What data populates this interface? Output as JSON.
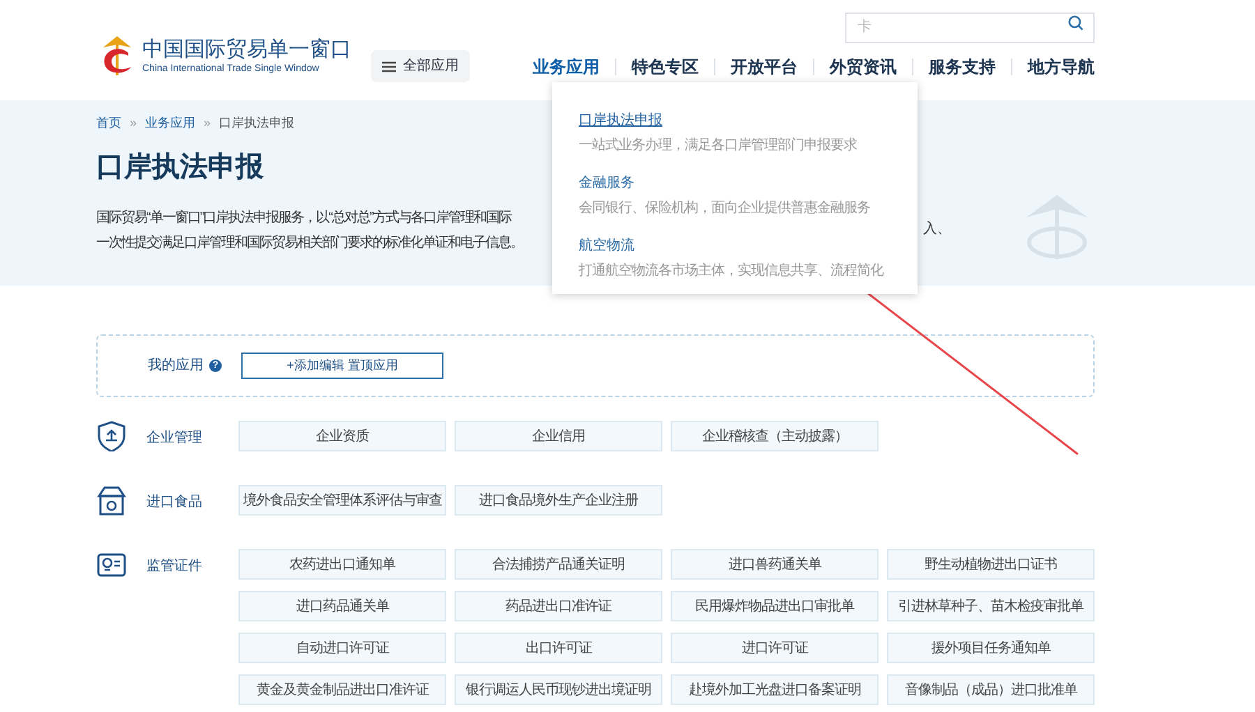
{
  "header": {
    "logo_title": "中国国际贸易单一窗口",
    "logo_subtitle": "China International Trade Single Window",
    "all_apps_button": "全部应用",
    "search": {
      "placeholder": "卡"
    },
    "nav": [
      {
        "label": "业务应用",
        "expanded": true
      },
      {
        "label": "特色专区",
        "expanded": false
      },
      {
        "label": "开放平台",
        "expanded": false
      },
      {
        "label": "外贸资讯",
        "expanded": false
      },
      {
        "label": "服务支持",
        "expanded": false
      },
      {
        "label": "地方导航",
        "expanded": false
      }
    ]
  },
  "dropdown": {
    "items": [
      {
        "title": "口岸执法申报",
        "description": "一站式业务办理，满足各口岸管理部门申报要求",
        "selected": true
      },
      {
        "title": "金融服务",
        "description": "会同银行、保险机构，面向企业提供普惠金融服务",
        "selected": false
      },
      {
        "title": "航空物流",
        "description": "打通航空物流各市场主体，实现信息共享、流程简化",
        "selected": false
      }
    ]
  },
  "breadcrumb": [
    {
      "label": "首页",
      "kind": "link"
    },
    {
      "label": "»",
      "kind": "separator"
    },
    {
      "label": "业务应用",
      "kind": "link"
    },
    {
      "label": "»",
      "kind": "separator"
    },
    {
      "label": "口岸执法申报",
      "kind": "current"
    }
  ],
  "page_title": "口岸执法申报",
  "intro": {
    "line_1": "国际贸易“单一窗口”口岸执法申报服务，以“总对总”方式与各口岸管理和国际",
    "line_1_end": "入、",
    "line_2": "一次性提交满足口岸管理和国际贸易相关部门要求的标准化单证和电子信息。"
  },
  "my_apps": {
    "label": "我的应用",
    "help": "?",
    "add_button": "+添加编辑 置顶应用"
  },
  "categories": [
    {
      "name": "企业管理",
      "kind": "shield",
      "apps": [
        "企业资质",
        "企业信用",
        "企业稽核查（主动披露）"
      ]
    },
    {
      "name": "进口食品",
      "kind": "food",
      "apps": [
        "境外食品安全管理体系评估与审查",
        "进口食品境外生产企业注册"
      ]
    },
    {
      "name": "监管证件",
      "kind": "certificate",
      "apps": [
        "农药进出口通知单",
        "合法捕捞产品通关证明",
        "进口兽药通关单",
        "野生动植物进出口证书",
        "进口药品通关单",
        "药品进出口准许证",
        "民用爆炸物品进出口审批单",
        "引进林草种子、苗木检疫审批单",
        "自动进口许可证",
        "出口许可证",
        "进口许可证",
        "援外项目任务通知单",
        "黄金及黄金制品进出口准许证",
        "银行调运人民币现钞进出境证明",
        "赴境外加工光盘进口备案证明",
        "音像制品（成品）进口批准单"
      ]
    }
  ]
}
